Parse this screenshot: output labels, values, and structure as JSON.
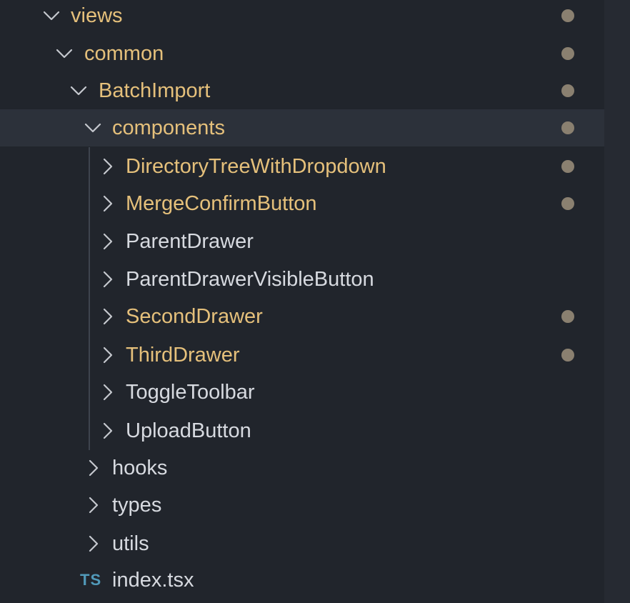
{
  "colors": {
    "background": "#21252c",
    "selected_row": "#2c313a",
    "modified_text": "#e5c07b",
    "default_text": "#d7dae0",
    "modified_dot": "#8a8070",
    "ts_icon": "#519aba",
    "indent_guide": "#3e444e"
  },
  "tree": {
    "items": [
      {
        "label": "views",
        "state": "expanded",
        "modified": true,
        "icon": "chevron-down-icon"
      },
      {
        "label": "common",
        "state": "expanded",
        "modified": true,
        "icon": "chevron-down-icon"
      },
      {
        "label": "BatchImport",
        "state": "expanded",
        "modified": true,
        "icon": "chevron-down-icon"
      },
      {
        "label": "components",
        "state": "expanded",
        "modified": true,
        "selected": true,
        "icon": "chevron-down-icon"
      },
      {
        "label": "DirectoryTreeWithDropdown",
        "state": "collapsed",
        "modified": true,
        "icon": "chevron-right-icon"
      },
      {
        "label": "MergeConfirmButton",
        "state": "collapsed",
        "modified": true,
        "icon": "chevron-right-icon"
      },
      {
        "label": "ParentDrawer",
        "state": "collapsed",
        "modified": false,
        "icon": "chevron-right-icon"
      },
      {
        "label": "ParentDrawerVisibleButton",
        "state": "collapsed",
        "modified": false,
        "icon": "chevron-right-icon"
      },
      {
        "label": "SecondDrawer",
        "state": "collapsed",
        "modified": true,
        "icon": "chevron-right-icon"
      },
      {
        "label": "ThirdDrawer",
        "state": "collapsed",
        "modified": true,
        "icon": "chevron-right-icon"
      },
      {
        "label": "ToggleToolbar",
        "state": "collapsed",
        "modified": false,
        "icon": "chevron-right-icon"
      },
      {
        "label": "UploadButton",
        "state": "collapsed",
        "modified": false,
        "icon": "chevron-right-icon"
      },
      {
        "label": "hooks",
        "state": "collapsed",
        "modified": false,
        "icon": "chevron-right-icon"
      },
      {
        "label": "types",
        "state": "collapsed",
        "modified": false,
        "icon": "chevron-right-icon"
      },
      {
        "label": "utils",
        "state": "collapsed",
        "modified": false,
        "icon": "chevron-right-icon"
      },
      {
        "label": "index.tsx",
        "state": "file",
        "modified": false,
        "icon": "typescript-file-icon",
        "icon_text": "TS"
      }
    ]
  }
}
